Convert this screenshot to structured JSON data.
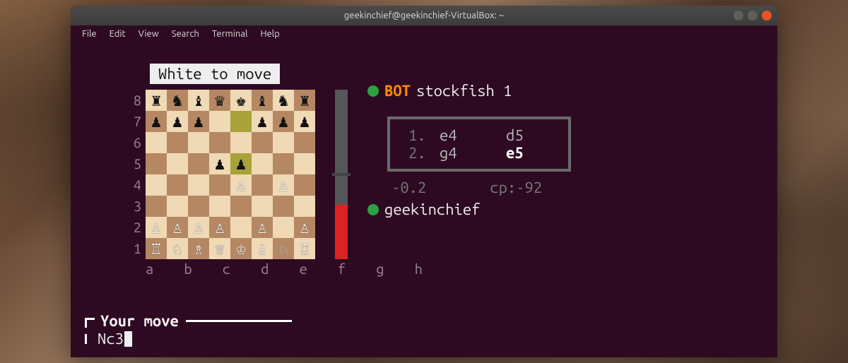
{
  "window": {
    "title": "geekinchief@geekinchief-VirtualBox: ~"
  },
  "menubar": [
    "File",
    "Edit",
    "View",
    "Search",
    "Terminal",
    "Help"
  ],
  "game": {
    "turn_banner": "White to move",
    "ranks": [
      "8",
      "7",
      "6",
      "5",
      "4",
      "3",
      "2",
      "1"
    ],
    "files_label": "a b c d e f g h",
    "board": [
      [
        "r",
        "n",
        "b",
        "q",
        "k",
        "b",
        "n",
        "r"
      ],
      [
        "P",
        "P",
        "P",
        "",
        "",
        "P",
        "P",
        "P"
      ],
      [
        "",
        "",
        "",
        "",
        "",
        "",
        "",
        ""
      ],
      [
        "",
        "",
        "",
        "P",
        "P",
        "",
        "",
        ""
      ],
      [
        "",
        "",
        "",
        "",
        "P",
        "",
        "P",
        ""
      ],
      [
        "",
        "",
        "",
        "",
        "",
        "",
        "",
        ""
      ],
      [
        "P",
        "P",
        "P",
        "P",
        "",
        "P",
        "",
        "P"
      ],
      [
        "R",
        "N",
        "B",
        "Q",
        "K",
        "B",
        "N",
        "R"
      ]
    ],
    "piece_colors": [
      [
        "b",
        "b",
        "b",
        "b",
        "b",
        "b",
        "b",
        "b"
      ],
      [
        "b",
        "b",
        "b",
        "",
        "",
        "b",
        "b",
        "b"
      ],
      [
        "",
        "",
        "",
        "",
        "",
        "",
        "",
        ""
      ],
      [
        "",
        "",
        "",
        "b",
        "b",
        "",
        "",
        ""
      ],
      [
        "",
        "",
        "",
        "",
        "w",
        "",
        "w",
        ""
      ],
      [
        "",
        "",
        "",
        "",
        "",
        "",
        "",
        ""
      ],
      [
        "w",
        "w",
        "w",
        "w",
        "",
        "w",
        "",
        "w"
      ],
      [
        "w",
        "w",
        "w",
        "w",
        "w",
        "w",
        "w",
        "w"
      ]
    ],
    "highlights": [
      [
        1,
        4
      ],
      [
        3,
        4
      ]
    ],
    "eval_bar": {
      "red_pct": 32
    }
  },
  "players": {
    "top": {
      "tag": "BOT",
      "name": "stockfish 1"
    },
    "bottom": {
      "name": "geekinchief"
    }
  },
  "moves": [
    {
      "n": "1.",
      "w": "e4",
      "b": "d5",
      "hl": ""
    },
    {
      "n": "2.",
      "w": "g4",
      "b": "e5",
      "hl": "b"
    }
  ],
  "eval": {
    "score": "-0.2",
    "cp": "cp:-92"
  },
  "prompt": {
    "label": "Your move",
    "input": "Nc3"
  }
}
